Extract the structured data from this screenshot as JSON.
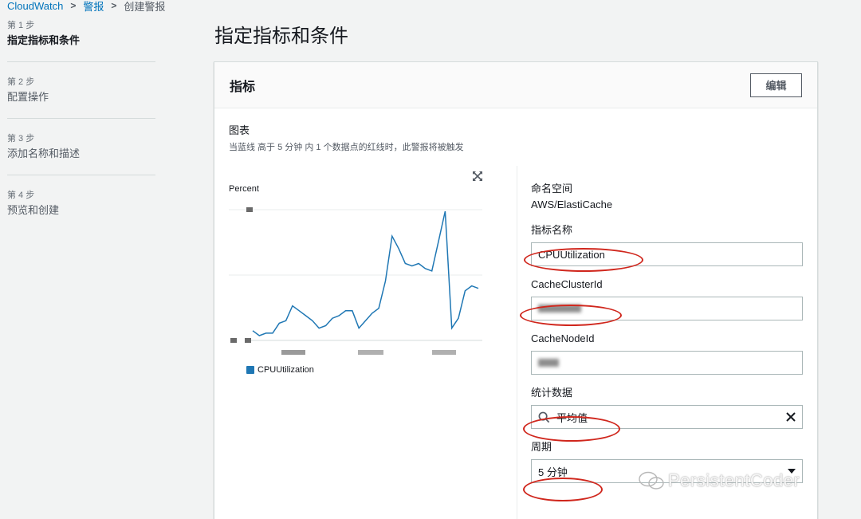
{
  "breadcrumb": {
    "root": "CloudWatch",
    "alarms": "警报",
    "current": "创建警报"
  },
  "steps": [
    {
      "num": "第 1 步",
      "title": "指定指标和条件"
    },
    {
      "num": "第 2 步",
      "title": "配置操作"
    },
    {
      "num": "第 3 步",
      "title": "添加名称和描述"
    },
    {
      "num": "第 4 步",
      "title": "预览和创建"
    }
  ],
  "page_title": "指定指标和条件",
  "panel": {
    "title": "指标",
    "edit_label": "编辑"
  },
  "graph": {
    "title": "图表",
    "description": "当蓝线 高于 5 分钟 内 1 个数据点的红线时，此警报将被触发",
    "y_label": "Percent",
    "legend": "CPUUtilization",
    "line_color": "#1f77b4",
    "values": [
      2,
      0,
      1,
      1,
      5,
      6,
      12,
      10,
      8,
      6,
      3,
      4,
      7,
      8,
      10,
      10,
      3,
      6,
      9,
      11,
      22,
      40,
      35,
      29,
      28,
      29,
      27,
      26,
      38,
      50,
      3,
      7,
      18,
      20,
      19
    ]
  },
  "fields": {
    "namespace": {
      "label": "命名空间",
      "value": "AWS/ElastiCache"
    },
    "metric_name": {
      "label": "指标名称",
      "value": "CPUUtilization"
    },
    "cache_cluster_id": {
      "label": "CacheClusterId"
    },
    "cache_node_id": {
      "label": "CacheNodeId"
    },
    "statistic": {
      "label": "统计数据",
      "value": "平均值"
    },
    "period": {
      "label": "周期",
      "value": "5 分钟"
    }
  },
  "colors": {
    "link": "#0073bb",
    "annotation": "#d0271d",
    "series": "#1f77b4"
  },
  "watermark": "PersistentCoder"
}
